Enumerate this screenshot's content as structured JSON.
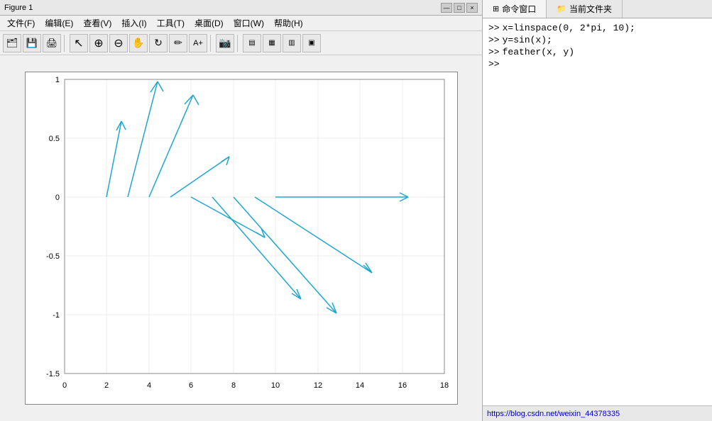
{
  "figure": {
    "title": "Figure 1",
    "title_bar_buttons": [
      "—",
      "□",
      "×"
    ],
    "menu_items": [
      {
        "label": "文件(F)"
      },
      {
        "label": "编辑(E)"
      },
      {
        "label": "查看(V)"
      },
      {
        "label": "插入(I)"
      },
      {
        "label": "工具(T)"
      },
      {
        "label": "桌面(D)"
      },
      {
        "label": "窗口(W)"
      },
      {
        "label": "帮助(H)"
      }
    ],
    "toolbar_buttons": [
      {
        "icon": "🗂",
        "name": "open"
      },
      {
        "icon": "💾",
        "name": "save"
      },
      {
        "icon": "🖨",
        "name": "print"
      },
      {
        "icon": "↖",
        "name": "select"
      },
      {
        "icon": "🔍",
        "name": "zoom-in"
      },
      {
        "icon": "🔍",
        "name": "zoom-out"
      },
      {
        "icon": "✋",
        "name": "pan"
      },
      {
        "icon": "↩",
        "name": "rotate"
      },
      {
        "icon": "✏",
        "name": "edit"
      },
      {
        "icon": "⊹",
        "name": "brush"
      },
      {
        "icon": "📷",
        "name": "camera"
      },
      {
        "icon": "📄",
        "name": "doc"
      },
      {
        "icon": "⬜",
        "name": "box1"
      },
      {
        "icon": "⬛",
        "name": "box2"
      },
      {
        "icon": "⬜",
        "name": "box3"
      }
    ]
  },
  "plot": {
    "x_axis": {
      "min": 0,
      "max": 18,
      "ticks": [
        0,
        2,
        4,
        6,
        8,
        10,
        12,
        14,
        16,
        18
      ]
    },
    "y_axis": {
      "min": -1.5,
      "max": 1,
      "ticks": [
        -1.5,
        -1,
        -0.5,
        0,
        0.5,
        1
      ]
    },
    "color": "#1ea6d0"
  },
  "right_panel": {
    "tabs": [
      {
        "label": "命令窗口",
        "icon": "⊞",
        "active": true
      },
      {
        "label": "当前文件夹",
        "icon": "📁",
        "active": false
      }
    ],
    "commands": [
      {
        "prompt": ">>",
        "text": "x=linspace(0, 2*pi, 10);"
      },
      {
        "prompt": ">>",
        "text": "y=sin(x);"
      },
      {
        "prompt": ">>",
        "text": "feather(x, y)"
      },
      {
        "prompt": ">>",
        "text": ""
      }
    ],
    "bottom_link": "https://blog.csdn.net/weixin_44378335"
  }
}
